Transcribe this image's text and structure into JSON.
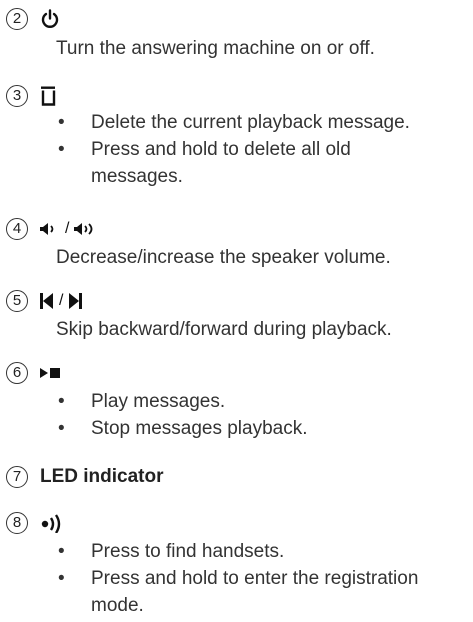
{
  "items": [
    {
      "number": "2",
      "icon": "power-icon",
      "description": "Turn the answering machine on or off."
    },
    {
      "number": "3",
      "icon": "delete-icon",
      "bullets": [
        "Delete the current playback message.",
        "Press and hold to delete all old",
        "messages."
      ]
    },
    {
      "number": "4",
      "icon": "volume-down-up-icon",
      "separator": "/",
      "description": "Decrease/increase the speaker volume."
    },
    {
      "number": "5",
      "icon": "skip-backward-forward-icon",
      "separator": "/",
      "description": "Skip backward/forward during playback."
    },
    {
      "number": "6",
      "icon": "play-stop-icon",
      "bullets": [
        "Play messages.",
        "Stop messages playback."
      ]
    },
    {
      "number": "7",
      "label": "LED indicator"
    },
    {
      "number": "8",
      "icon": "find-handset-icon",
      "bullets": [
        "Press to find handsets.",
        "Press and hold to enter the registration",
        "mode."
      ]
    }
  ],
  "bullet_char": "•"
}
